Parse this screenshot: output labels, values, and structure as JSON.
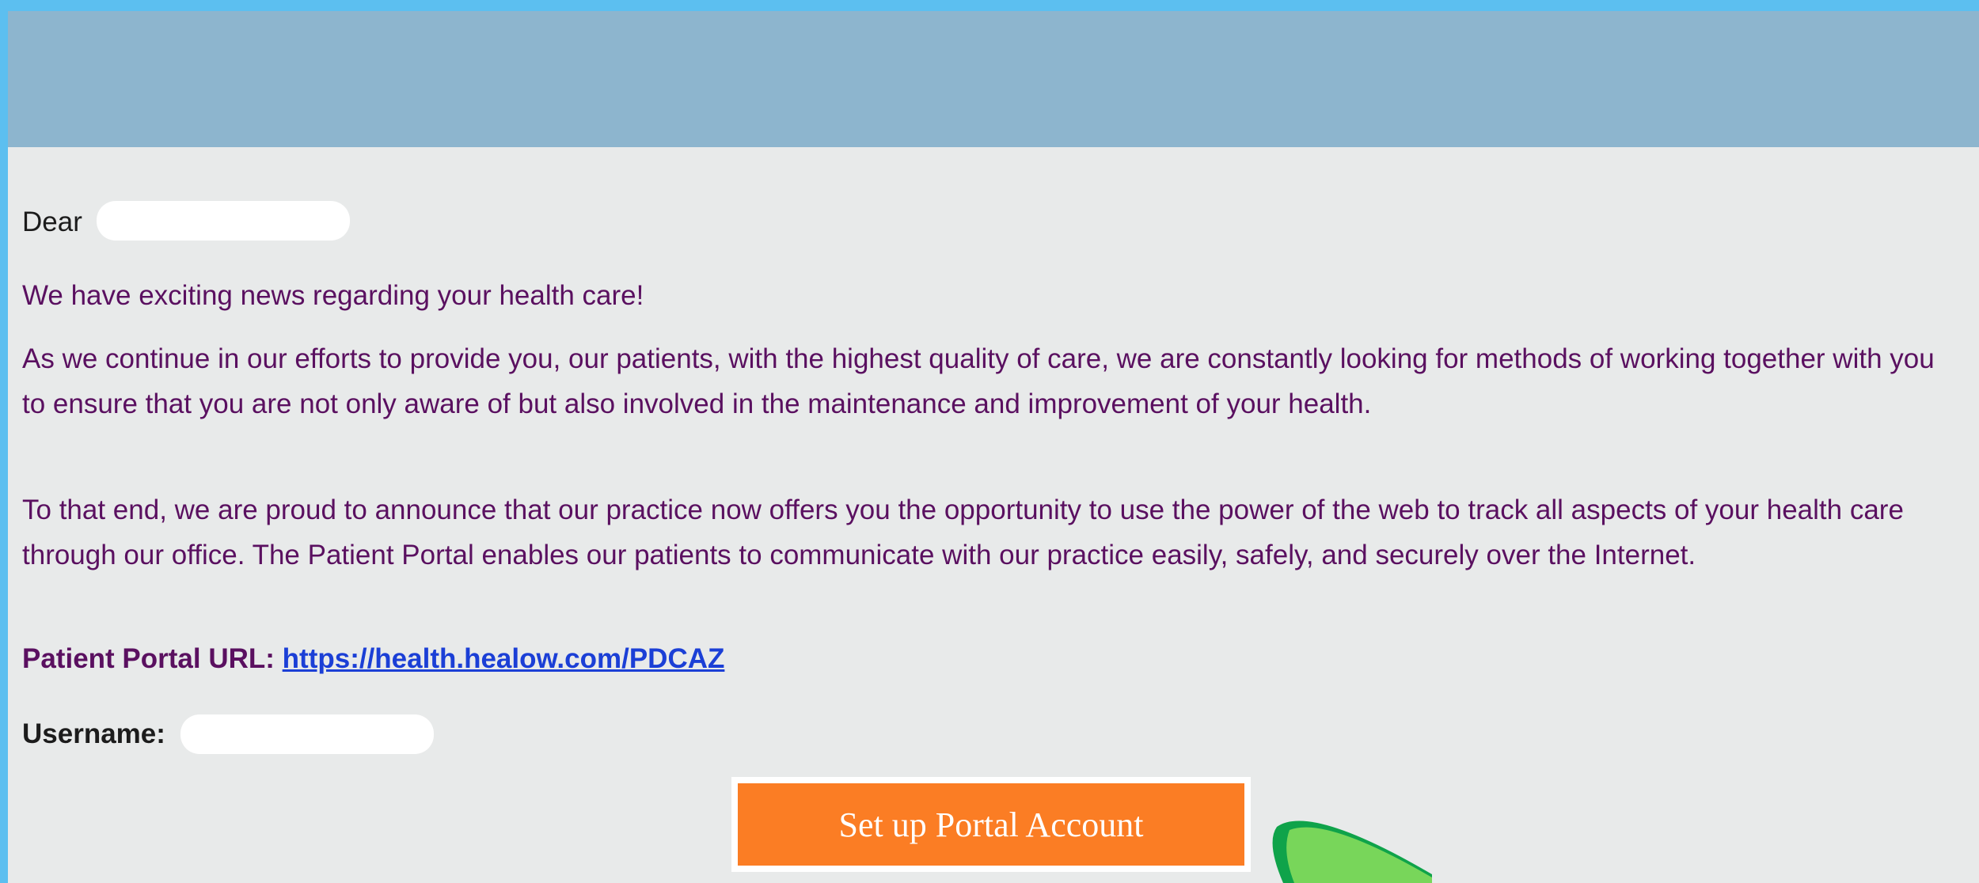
{
  "email": {
    "greeting_label": "Dear",
    "intro": "We have exciting news regarding your health care!",
    "paragraph1": "As we continue in our efforts to provide you, our patients, with the highest quality of care, we are constantly looking for methods of working together with you to ensure that you are not only aware of but also involved in the maintenance and improvement of your health.",
    "paragraph2": "To that end, we are proud to announce that our practice now offers you the opportunity to use the power of the web to track all aspects of your health care through our office.  The Patient Portal enables our patients to communicate with our practice easily, safely, and securely over the Internet.",
    "portal_url_label": "Patient Portal URL:",
    "portal_url": "https://health.healow.com/PDCAZ",
    "username_label": "Username:",
    "cta_label": "Set up Portal Account"
  },
  "colors": {
    "outer_background": "#5cbff0",
    "header_banner": "#8db5ce",
    "body_background": "#e8eaea",
    "body_text": "#5a1060",
    "link": "#1b3fd6",
    "cta_button": "#fb7d24",
    "cursor_arrow": "#78d65a"
  },
  "icons": {
    "cursor": "arrow-cursor-icon"
  }
}
